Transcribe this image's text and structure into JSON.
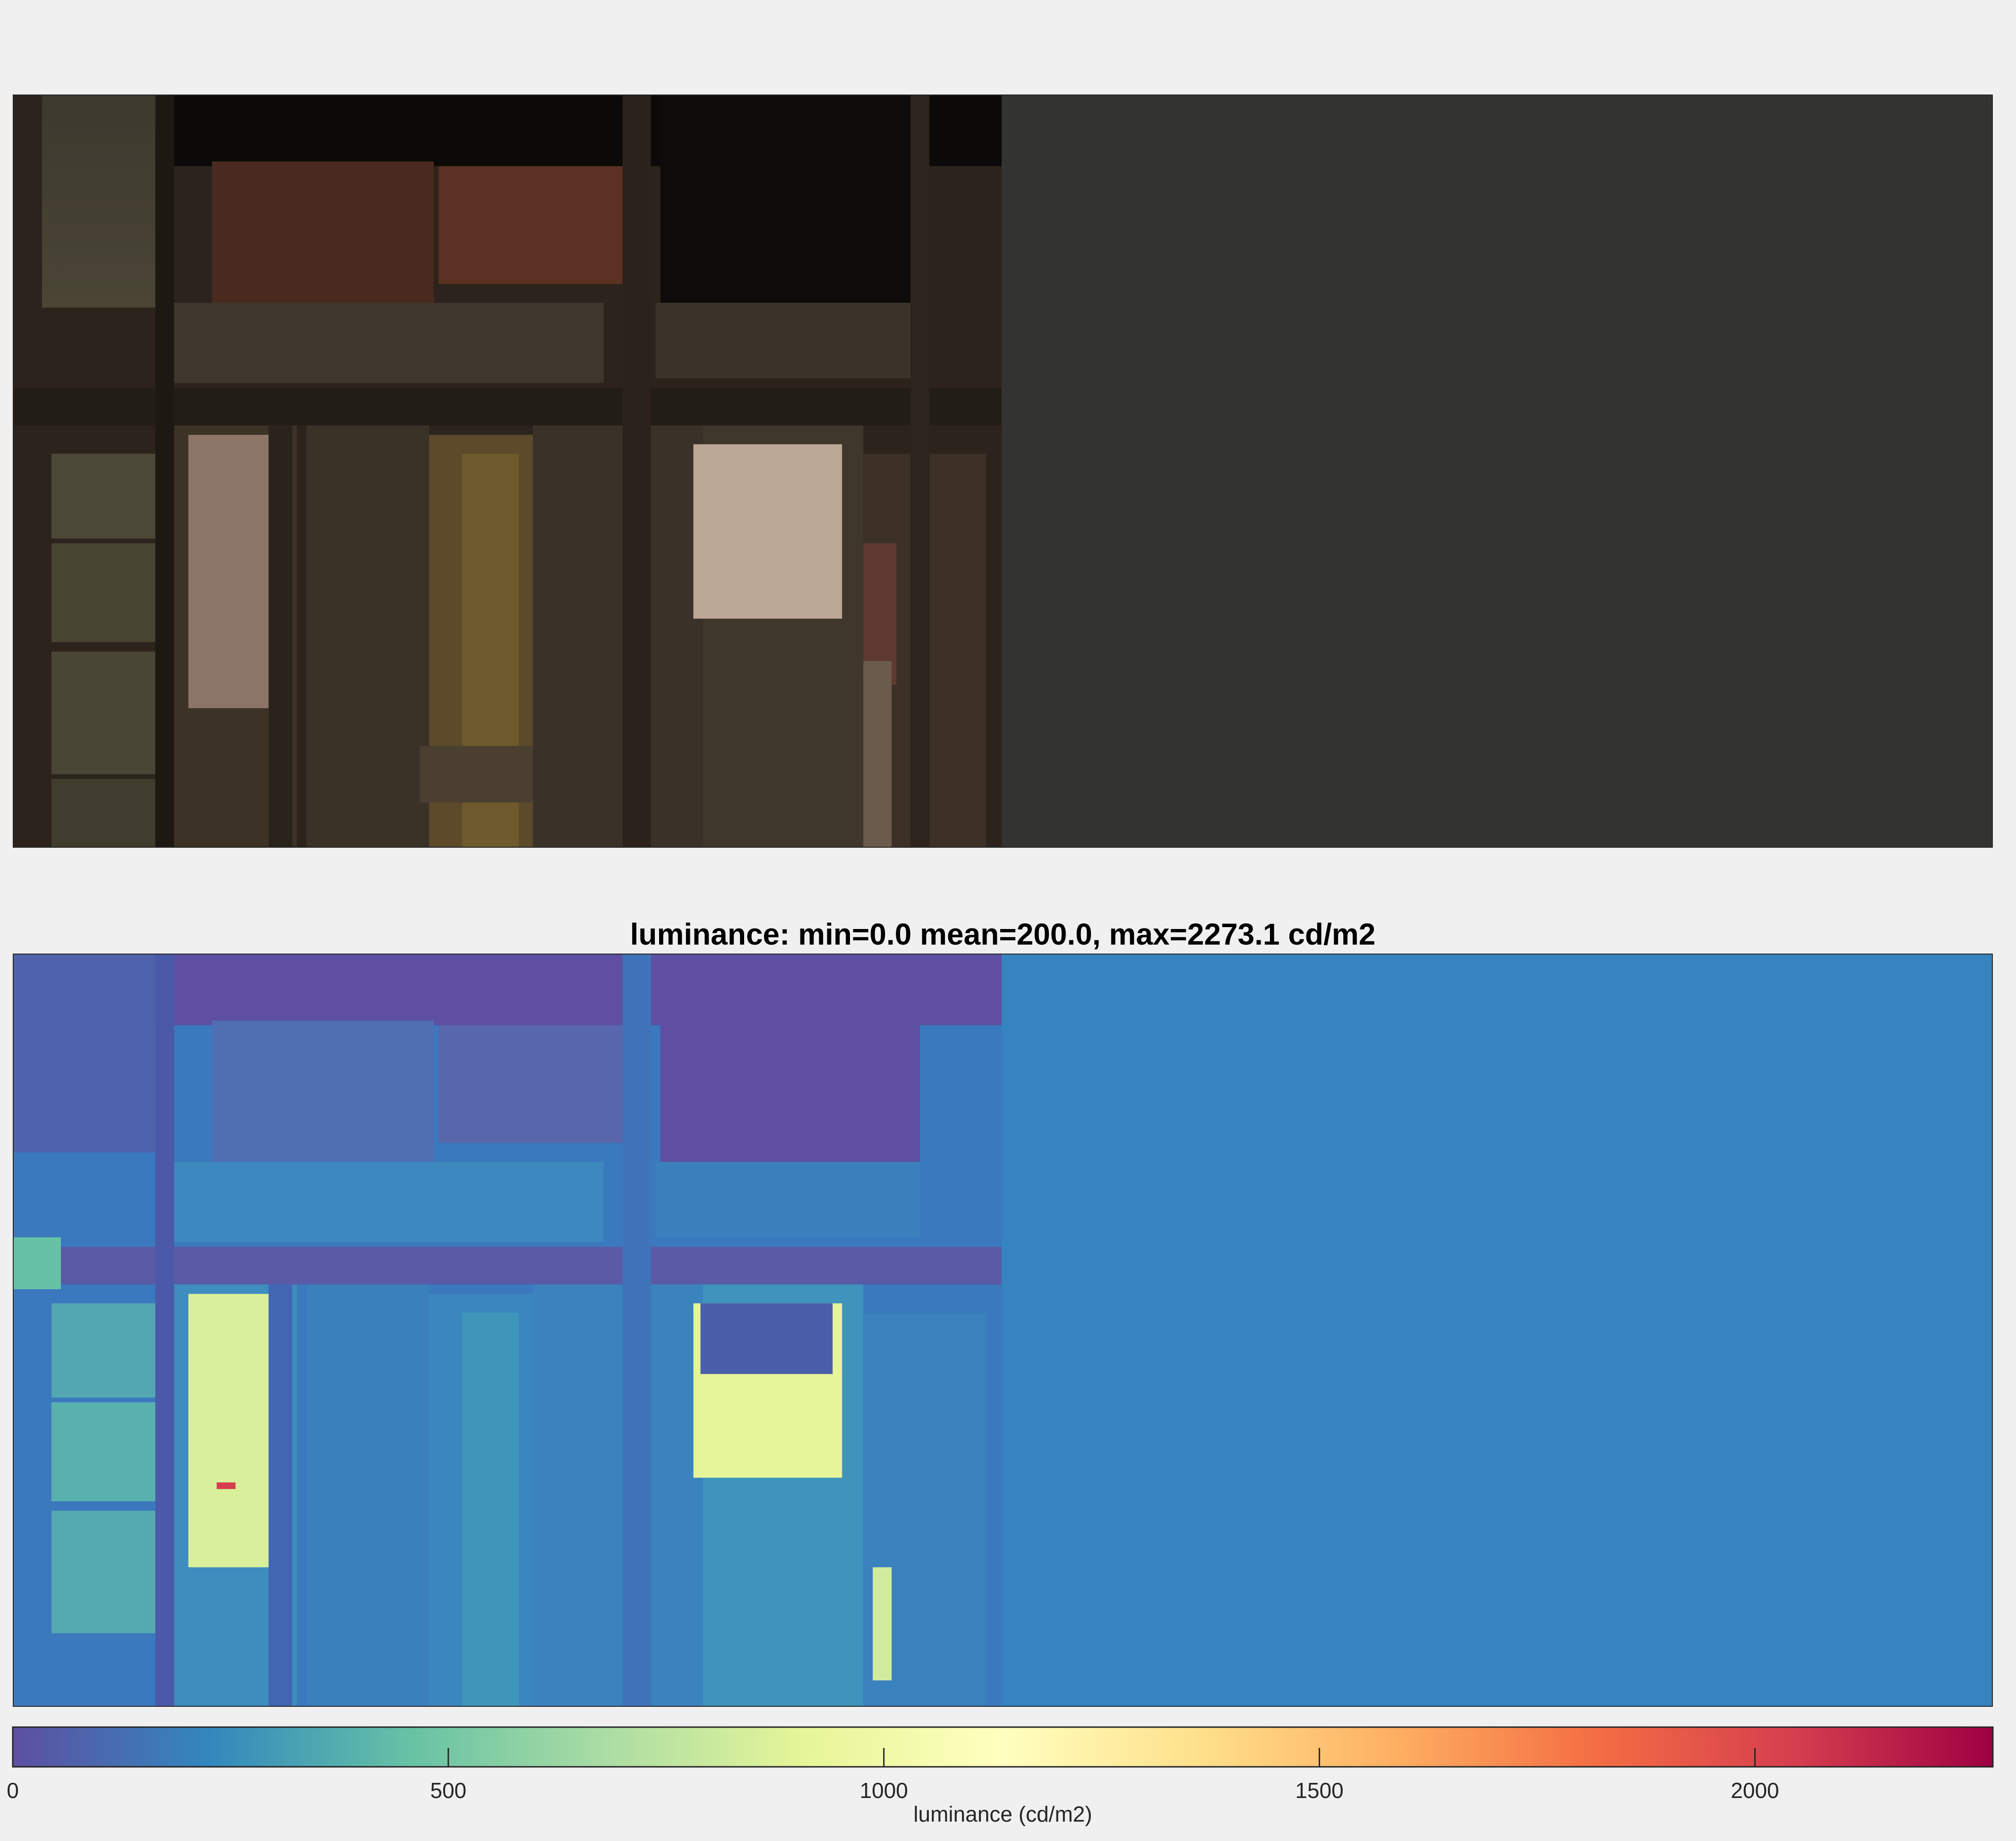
{
  "figure": {
    "top_panel": {
      "content": "RGB photograph of an old weathered wooden barn wall with stone pillar, left half of panel; right half uniform dark gray"
    },
    "bottom_panel": {
      "title": "luminance: min=0.0 mean=200.0, max=2273.1 cd/m2",
      "colormap": "spectral (purple-blue-green-yellow-orange-red)"
    },
    "colorbar": {
      "label": "luminance (cd/m2)",
      "range": [
        0,
        2273.1
      ],
      "ticks": [
        {
          "value": 0,
          "label": "0"
        },
        {
          "value": 500,
          "label": "500"
        },
        {
          "value": 1000,
          "label": "1000"
        },
        {
          "value": 1500,
          "label": "1500"
        },
        {
          "value": 2000,
          "label": "2000"
        }
      ]
    },
    "colors": {
      "background": "#f0f0f0",
      "gray_fill_top": "#333332",
      "blue_fill_bottom": "#3584c0"
    }
  }
}
